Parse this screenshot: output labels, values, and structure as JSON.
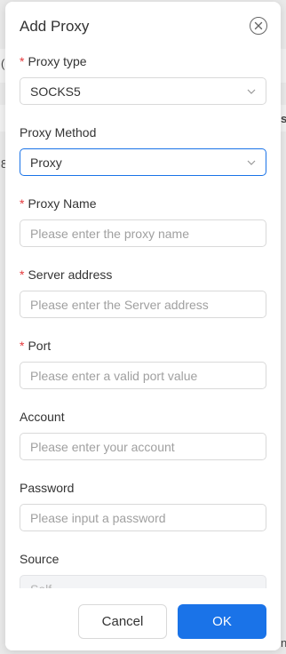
{
  "background": {
    "frag_c": "(",
    "frag_s": "s",
    "frag_8": "8",
    "frag_n": "n"
  },
  "modal": {
    "title": "Add Proxy",
    "close_icon": "close-circle-icon"
  },
  "form": {
    "proxy_type": {
      "label": "Proxy type",
      "required": true,
      "value": "SOCKS5"
    },
    "proxy_method": {
      "label": "Proxy Method",
      "required": false,
      "value": "Proxy"
    },
    "proxy_name": {
      "label": "Proxy Name",
      "required": true,
      "placeholder": "Please enter the proxy name"
    },
    "server_address": {
      "label": "Server address",
      "required": true,
      "placeholder": "Please enter the Server address"
    },
    "port": {
      "label": "Port",
      "required": true,
      "placeholder": "Please enter a valid port value"
    },
    "account": {
      "label": "Account",
      "required": false,
      "placeholder": "Please enter your account"
    },
    "password": {
      "label": "Password",
      "required": false,
      "placeholder": "Please input a password"
    },
    "source": {
      "label": "Source",
      "required": false,
      "placeholder": "Self"
    }
  },
  "footer": {
    "cancel_label": "Cancel",
    "ok_label": "OK"
  },
  "colors": {
    "accent": "#1a73e8",
    "required": "#e4393c"
  }
}
